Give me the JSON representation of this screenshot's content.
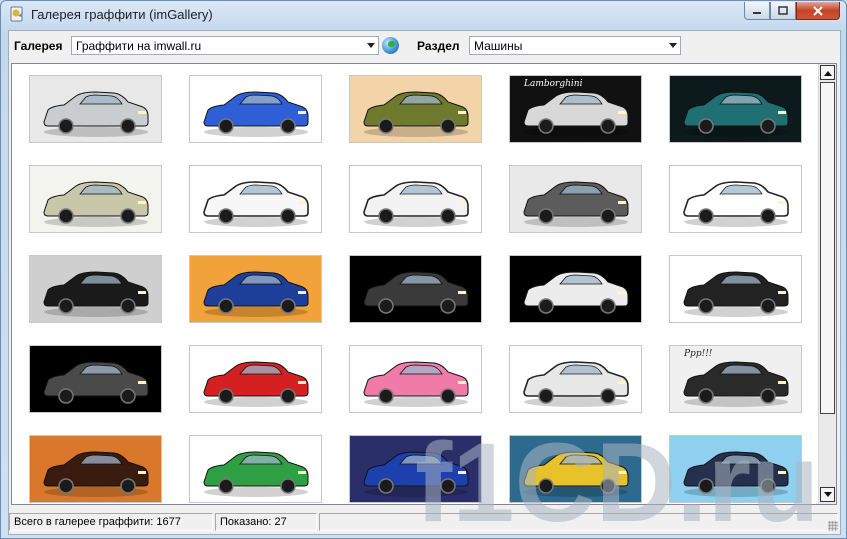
{
  "window": {
    "title": "Галерея граффити (imGallery)"
  },
  "toolbar": {
    "gallery_label": "Галерея",
    "gallery_value": "Граффити на imwall.ru",
    "section_label": "Раздел",
    "section_value": "Машины"
  },
  "thumbnails": [
    {
      "name": "thumb-silver-camaro",
      "bg": "#e8e8e8",
      "car": "#c9cdd0",
      "style": "normal",
      "text": ""
    },
    {
      "name": "thumb-blue-toon-car",
      "bg": "#ffffff",
      "car": "#2f5fd6",
      "style": "normal",
      "text": ""
    },
    {
      "name": "thumb-green-jeep",
      "bg": "#f3d3a8",
      "car": "#6f7a2e",
      "style": "normal",
      "text": ""
    },
    {
      "name": "thumb-lamborghini",
      "bg": "#111111",
      "car": "#d8d8d8",
      "style": "normal",
      "text": "Lamborghini"
    },
    {
      "name": "thumb-teal-suv",
      "bg": "#0c1a1c",
      "car": "#1f6f73",
      "style": "normal",
      "text": ""
    },
    {
      "name": "thumb-mercedes-sedan",
      "bg": "#f4f4ef",
      "car": "#c8c7a9",
      "style": "normal",
      "text": ""
    },
    {
      "name": "thumb-white-honda",
      "bg": "#ffffff",
      "car": "#f7f7f7",
      "style": "sketch",
      "text": ""
    },
    {
      "name": "thumb-white-audi-r8",
      "bg": "#ffffff",
      "car": "#f2f2f2",
      "style": "sketch",
      "text": ""
    },
    {
      "name": "thumb-wrecked-car",
      "bg": "#e9e9e9",
      "car": "#5c5c5c",
      "style": "normal",
      "text": ""
    },
    {
      "name": "thumb-sketch-muscle-car",
      "bg": "#ffffff",
      "car": "#ffffff",
      "style": "sketch",
      "text": ""
    },
    {
      "name": "thumb-black-lincoln",
      "bg": "#cfcfcf",
      "car": "#1a1a1a",
      "style": "normal",
      "text": ""
    },
    {
      "name": "thumb-blue-classic",
      "bg": "#f2a23a",
      "car": "#1d3f99",
      "style": "normal",
      "text": ""
    },
    {
      "name": "thumb-black-mustang",
      "bg": "#000000",
      "car": "#3a3a3a",
      "style": "normal",
      "text": ""
    },
    {
      "name": "thumb-black-plymouth",
      "bg": "#000000",
      "car": "#ececec",
      "style": "normal",
      "text": ""
    },
    {
      "name": "thumb-black-charger",
      "bg": "#ffffff",
      "car": "#222222",
      "style": "normal",
      "text": ""
    },
    {
      "name": "thumb-dark-camaro",
      "bg": "#000000",
      "car": "#4a4a4a",
      "style": "normal",
      "text": ""
    },
    {
      "name": "thumb-red-lancer",
      "bg": "#ffffff",
      "car": "#d42020",
      "style": "normal",
      "text": ""
    },
    {
      "name": "thumb-pink-classic",
      "bg": "#ffffff",
      "car": "#f07aa8",
      "style": "normal",
      "text": ""
    },
    {
      "name": "thumb-white-bmw",
      "bg": "#ffffff",
      "car": "#e7e7e7",
      "style": "sketch",
      "text": ""
    },
    {
      "name": "thumb-black-golf",
      "bg": "#f0f0f0",
      "car": "#2a2a2a",
      "style": "normal",
      "text": "Ppp!!!"
    },
    {
      "name": "thumb-sunset-car",
      "bg": "#d9782a",
      "car": "#3a1b10",
      "style": "normal",
      "text": ""
    },
    {
      "name": "thumb-green-zaporozhets",
      "bg": "#ffffff",
      "car": "#2ea043",
      "style": "normal",
      "text": ""
    },
    {
      "name": "thumb-blue-mini",
      "bg": "#2a2f6a",
      "car": "#1e3fae",
      "style": "normal",
      "text": ""
    },
    {
      "name": "thumb-yellow-car",
      "bg": "#2e6a8e",
      "car": "#e7c22a",
      "style": "normal",
      "text": ""
    },
    {
      "name": "thumb-sky-car",
      "bg": "#8fd0f0",
      "car": "#24304d",
      "style": "normal",
      "text": ""
    }
  ],
  "status": {
    "total": "Всего в галерее граффити: 1677",
    "shown": "Показано: 27",
    "extra": ""
  },
  "watermark": {
    "text": "f1CD.ru"
  }
}
